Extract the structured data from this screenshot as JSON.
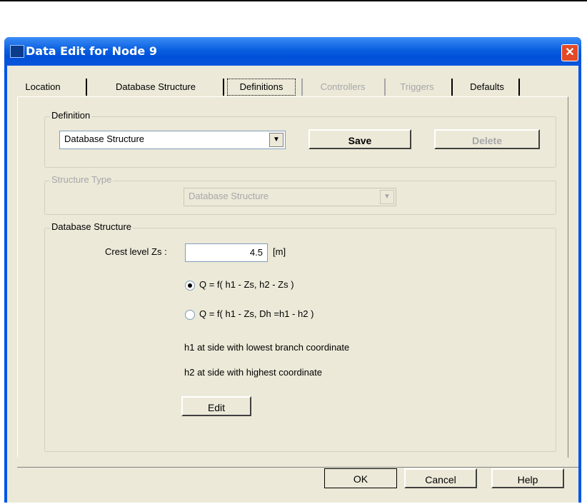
{
  "window": {
    "title": "Data Edit for Node 9"
  },
  "tabs": [
    {
      "label": "Location"
    },
    {
      "label": "Database Structure"
    },
    {
      "label": "Definitions"
    },
    {
      "label": "Controllers"
    },
    {
      "label": "Triggers"
    },
    {
      "label": "Defaults"
    }
  ],
  "definition": {
    "legend": "Definition",
    "selected": "Database Structure",
    "save_label": "Save",
    "delete_label": "Delete"
  },
  "structure_type": {
    "legend": "Structure Type",
    "selected": "Database Structure"
  },
  "database_structure": {
    "legend": "Database Structure",
    "crest_label": "Crest level Zs :",
    "crest_value": "4.5",
    "crest_unit": "[m]",
    "option1": "Q = f( h1 - Zs, h2 - Zs )",
    "option2": "Q = f( h1 - Zs, Dh =h1 - h2 )",
    "note1": "h1 at side with lowest branch coordinate",
    "note2": "h2 at side with highest coordinate",
    "edit_label": "Edit"
  },
  "footer": {
    "ok_label": "OK",
    "cancel_label": "Cancel",
    "help_label": "Help"
  }
}
